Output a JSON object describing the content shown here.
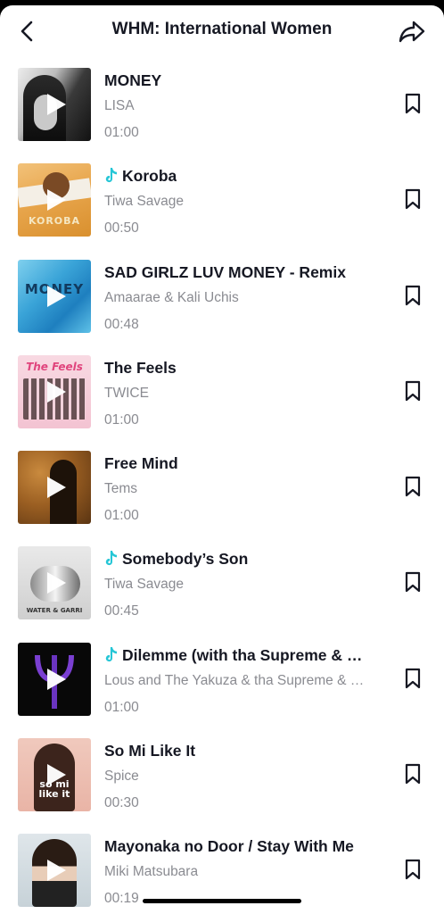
{
  "header": {
    "title": "WHM: International Women",
    "back_icon": "chevron-left-icon",
    "share_icon": "share-arrow-icon"
  },
  "colors": {
    "tiktok_note": "#25c6d6",
    "title_text": "#161823",
    "secondary_text": "#8a8b91"
  },
  "songs": [
    {
      "title": "MONEY",
      "artist": "LISA",
      "duration": "01:00",
      "tiktok_original": false
    },
    {
      "title": "Koroba",
      "artist": "Tiwa Savage",
      "duration": "00:50",
      "tiktok_original": true,
      "cover_text": "KOROBA"
    },
    {
      "title": "SAD GIRLZ LUV MONEY - Remix",
      "artist": "Amaarae & Kali Uchis",
      "duration": "00:48",
      "tiktok_original": false,
      "cover_text": "MONEY"
    },
    {
      "title": "The Feels",
      "artist": "TWICE",
      "duration": "01:00",
      "tiktok_original": false,
      "cover_text": "The Feels"
    },
    {
      "title": "Free Mind",
      "artist": "Tems",
      "duration": "01:00",
      "tiktok_original": false
    },
    {
      "title": "Somebody’s Son",
      "artist": "Tiwa Savage",
      "duration": "00:45",
      "tiktok_original": true,
      "cover_text": "WATER & GARRI"
    },
    {
      "title": "Dilemme (with tha Supreme & Mara Sattei)",
      "artist": "Lous and The Yakuza & tha Supreme & Mara Sattei",
      "duration": "01:00",
      "tiktok_original": true
    },
    {
      "title": "So Mi Like It",
      "artist": "Spice",
      "duration": "00:30",
      "tiktok_original": false,
      "cover_text": "so mi like it"
    },
    {
      "title": "Mayonaka no Door / Stay With Me",
      "artist": "Miki Matsubara",
      "duration": "00:19",
      "tiktok_original": false
    }
  ]
}
